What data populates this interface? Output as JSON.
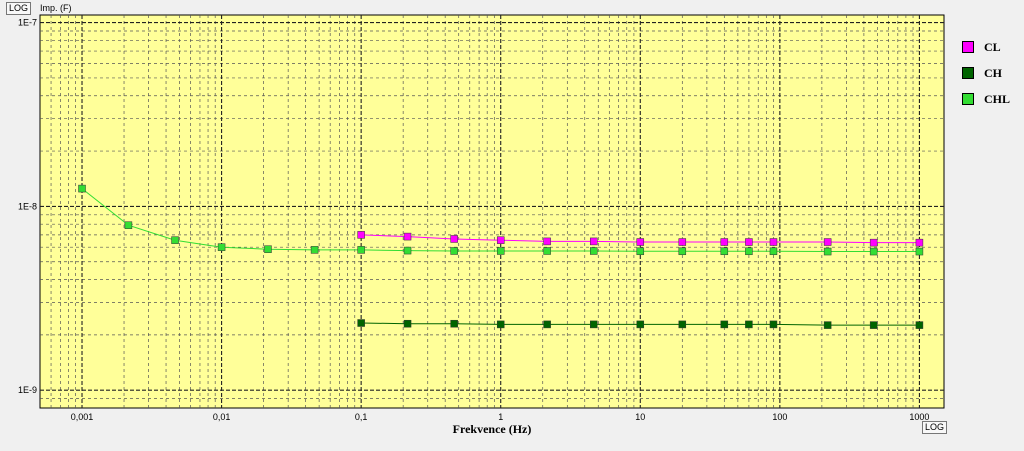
{
  "badges": {
    "y_scale": "LOG",
    "x_scale": "LOG"
  },
  "chart_data": {
    "type": "line",
    "ylabel": "Imp. (F)",
    "xlabel": "Frekvence (Hz)",
    "x_scale": "log",
    "y_scale": "log",
    "xlim": [
      0.0005,
      1500
    ],
    "ylim": [
      8e-10,
      1.1e-07
    ],
    "x_ticks": [
      {
        "value": 0.001,
        "label": "0,001"
      },
      {
        "value": 0.01,
        "label": "0,01"
      },
      {
        "value": 0.1,
        "label": "0,1"
      },
      {
        "value": 1,
        "label": "1"
      },
      {
        "value": 10,
        "label": "10"
      },
      {
        "value": 100,
        "label": "100"
      },
      {
        "value": 1000,
        "label": "1000"
      }
    ],
    "y_ticks": [
      {
        "value": 1e-09,
        "label": "1E-9"
      },
      {
        "value": 1e-08,
        "label": "1E-8"
      },
      {
        "value": 1e-07,
        "label": "1E-7"
      }
    ],
    "grid": true,
    "background": "#ffff99",
    "legend_position": "right",
    "series": [
      {
        "name": "CL",
        "color": "#ff00ff",
        "x": [
          0.1,
          0.215,
          0.464,
          1,
          2.15,
          4.64,
          10,
          20,
          40,
          60,
          90,
          220,
          470,
          1000
        ],
        "y": [
          7e-09,
          6.85e-09,
          6.65e-09,
          6.55e-09,
          6.45e-09,
          6.45e-09,
          6.4e-09,
          6.4e-09,
          6.4e-09,
          6.4e-09,
          6.4e-09,
          6.4e-09,
          6.35e-09,
          6.35e-09
        ]
      },
      {
        "name": "CH",
        "color": "#006400",
        "x": [
          0.1,
          0.215,
          0.464,
          1,
          2.15,
          4.64,
          10,
          20,
          40,
          60,
          90,
          220,
          470,
          1000
        ],
        "y": [
          2.32e-09,
          2.3e-09,
          2.3e-09,
          2.28e-09,
          2.28e-09,
          2.28e-09,
          2.28e-09,
          2.28e-09,
          2.28e-09,
          2.28e-09,
          2.28e-09,
          2.26e-09,
          2.26e-09,
          2.26e-09
        ]
      },
      {
        "name": "CHL",
        "color": "#33dd33",
        "x": [
          0.001,
          0.00215,
          0.00464,
          0.01,
          0.0215,
          0.0464,
          0.1,
          0.215,
          0.464,
          1,
          2.15,
          4.64,
          10,
          20,
          40,
          60,
          90,
          220,
          470,
          1000
        ],
        "y": [
          1.25e-08,
          7.9e-09,
          6.55e-09,
          6e-09,
          5.85e-09,
          5.8e-09,
          5.8e-09,
          5.75e-09,
          5.72e-09,
          5.72e-09,
          5.72e-09,
          5.72e-09,
          5.7e-09,
          5.7e-09,
          5.7e-09,
          5.7e-09,
          5.7e-09,
          5.68e-09,
          5.68e-09,
          5.68e-09
        ]
      }
    ]
  }
}
